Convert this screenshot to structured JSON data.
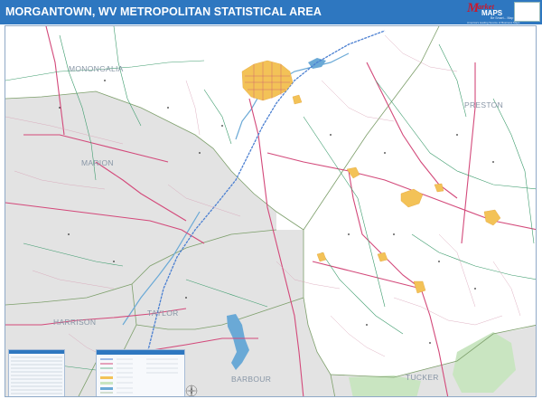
{
  "header": {
    "title": "MORGANTOWN, WV METROPOLITAN STATISTICAL AREA"
  },
  "logo": {
    "brand_initial": "M",
    "brand_word1": "arket",
    "brand_word2": "MAPS",
    "tagline": "Be Smart... Map Smart",
    "subtagline": "America's leading Source of Business Maps"
  },
  "map": {
    "county_labels": [
      {
        "name": "MONONGALIA"
      },
      {
        "name": "PRESTON"
      },
      {
        "name": "MARION"
      },
      {
        "name": "HARRISON"
      },
      {
        "name": "TAYLOR"
      },
      {
        "name": "BARBOUR"
      },
      {
        "name": "TUCKER"
      }
    ]
  },
  "colors": {
    "title_bar": "#2e77c0",
    "highway": "#cf3a6a",
    "secondary_road": "#3a9a6a",
    "county_line": "#7d9f6b",
    "urban_area": "#f3c257",
    "shaded_county": "#e2e2e2",
    "water": "#6aa9d6",
    "park": "#c5e3bd"
  }
}
